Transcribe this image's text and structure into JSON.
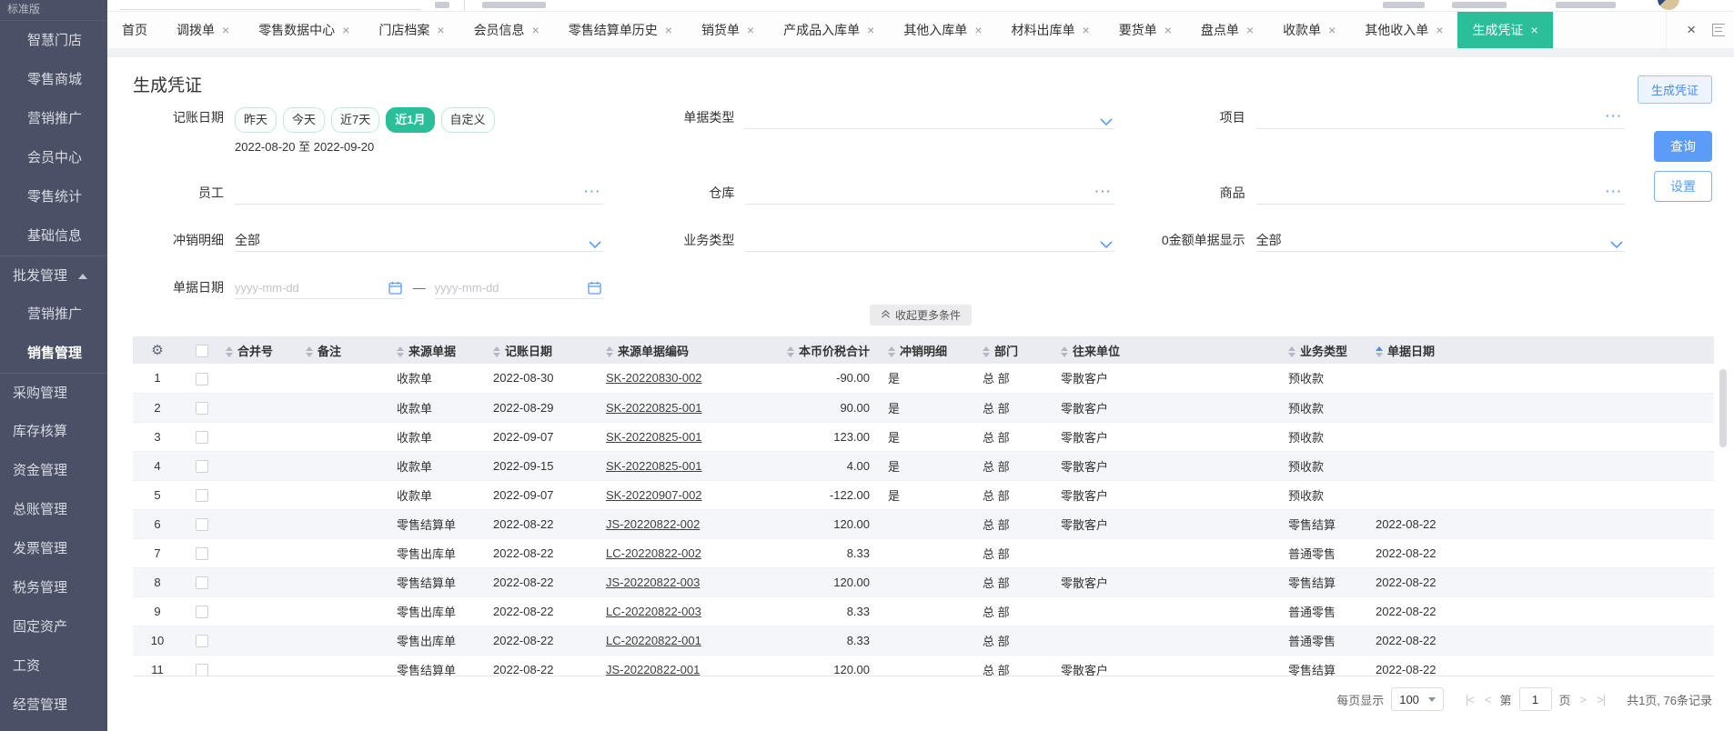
{
  "sidebar": {
    "edition_label": "标准版",
    "items": [
      {
        "label": "智慧门店",
        "level": 1
      },
      {
        "label": "零售商城",
        "level": 1
      },
      {
        "label": "营销推广",
        "level": 1
      },
      {
        "label": "会员中心",
        "level": 1
      },
      {
        "label": "零售统计",
        "level": 1
      },
      {
        "label": "基础信息",
        "level": 1
      },
      {
        "label": "批发管理",
        "level": 0,
        "expanded": true,
        "divider_above": true
      },
      {
        "label": "营销推广",
        "level": 1
      },
      {
        "label": "销售管理",
        "level": 1,
        "active": true
      },
      {
        "label": "采购管理",
        "level": 0,
        "divider_above": true
      },
      {
        "label": "库存核算",
        "level": 0
      },
      {
        "label": "资金管理",
        "level": 0
      },
      {
        "label": "总账管理",
        "level": 0
      },
      {
        "label": "发票管理",
        "level": 0
      },
      {
        "label": "税务管理",
        "level": 0
      },
      {
        "label": "固定资产",
        "level": 0
      },
      {
        "label": "工资",
        "level": 0
      },
      {
        "label": "经营管理",
        "level": 0
      }
    ]
  },
  "tabs": [
    {
      "label": "首页",
      "closable": false,
      "active": false
    },
    {
      "label": "调拨单",
      "closable": true,
      "active": false
    },
    {
      "label": "零售数据中心",
      "closable": true,
      "active": false
    },
    {
      "label": "门店档案",
      "closable": true,
      "active": false
    },
    {
      "label": "会员信息",
      "closable": true,
      "active": false
    },
    {
      "label": "零售结算单历史",
      "closable": true,
      "active": false
    },
    {
      "label": "销货单",
      "closable": true,
      "active": false
    },
    {
      "label": "产成品入库单",
      "closable": true,
      "active": false
    },
    {
      "label": "其他入库单",
      "closable": true,
      "active": false
    },
    {
      "label": "材料出库单",
      "closable": true,
      "active": false
    },
    {
      "label": "要货单",
      "closable": true,
      "active": false
    },
    {
      "label": "盘点单",
      "closable": true,
      "active": false
    },
    {
      "label": "收款单",
      "closable": true,
      "active": false
    },
    {
      "label": "其他收入单",
      "closable": true,
      "active": false
    },
    {
      "label": "生成凭证",
      "closable": true,
      "active": true
    }
  ],
  "page": {
    "title": "生成凭证",
    "generate_button_label": "生成凭证"
  },
  "filters": {
    "accounting_date": {
      "label": "记账日期",
      "quick_options": [
        "昨天",
        "今天",
        "近7天",
        "近1月",
        "自定义"
      ],
      "active_option": "近1月",
      "range_text": "2022-08-20 至 2022-09-20"
    },
    "doc_type": {
      "label": "单据类型",
      "value": ""
    },
    "project": {
      "label": "项目",
      "value": ""
    },
    "employee": {
      "label": "员工",
      "value": ""
    },
    "warehouse": {
      "label": "仓库",
      "value": ""
    },
    "goods": {
      "label": "商品",
      "value": ""
    },
    "writeoff_detail": {
      "label": "冲销明细",
      "value": "全部"
    },
    "business_type": {
      "label": "业务类型",
      "value": ""
    },
    "zero_amount": {
      "label": "0金额单据显示",
      "value": "全部"
    },
    "doc_date": {
      "label": "单据日期",
      "placeholder": "yyyy-mm-dd",
      "separator": "—"
    },
    "collapse_button_label": "收起更多条件",
    "query_button_label": "查询",
    "settings_button_label": "设置"
  },
  "table": {
    "columns": [
      "合并号",
      "备注",
      "来源单据",
      "记账日期",
      "来源单据编码",
      "本币价税合计",
      "冲销明细",
      "部门",
      "往来单位",
      "业务类型",
      "单据日期"
    ],
    "sorted_column": "单据日期",
    "sort_direction": "asc",
    "rows": [
      {
        "num": "1",
        "merge_no": "",
        "remark": "",
        "source_doc": "收款单",
        "acct_date": "2022-08-30",
        "code": "SK-20220830-002",
        "amount": "-90.00",
        "writeoff": "是",
        "dept": "总 部",
        "partner": "零散客户",
        "biz_type": "预收款",
        "doc_date": ""
      },
      {
        "num": "2",
        "merge_no": "",
        "remark": "",
        "source_doc": "收款单",
        "acct_date": "2022-08-29",
        "code": "SK-20220825-001",
        "amount": "90.00",
        "writeoff": "是",
        "dept": "总 部",
        "partner": "零散客户",
        "biz_type": "预收款",
        "doc_date": ""
      },
      {
        "num": "3",
        "merge_no": "",
        "remark": "",
        "source_doc": "收款单",
        "acct_date": "2022-09-07",
        "code": "SK-20220825-001",
        "amount": "123.00",
        "writeoff": "是",
        "dept": "总 部",
        "partner": "零散客户",
        "biz_type": "预收款",
        "doc_date": ""
      },
      {
        "num": "4",
        "merge_no": "",
        "remark": "",
        "source_doc": "收款单",
        "acct_date": "2022-09-15",
        "code": "SK-20220825-001",
        "amount": "4.00",
        "writeoff": "是",
        "dept": "总 部",
        "partner": "零散客户",
        "biz_type": "预收款",
        "doc_date": ""
      },
      {
        "num": "5",
        "merge_no": "",
        "remark": "",
        "source_doc": "收款单",
        "acct_date": "2022-09-07",
        "code": "SK-20220907-002",
        "amount": "-122.00",
        "writeoff": "是",
        "dept": "总 部",
        "partner": "零散客户",
        "biz_type": "预收款",
        "doc_date": ""
      },
      {
        "num": "6",
        "merge_no": "",
        "remark": "",
        "source_doc": "零售结算单",
        "acct_date": "2022-08-22",
        "code": "JS-20220822-002",
        "amount": "120.00",
        "writeoff": "",
        "dept": "总 部",
        "partner": "零散客户",
        "biz_type": "零售结算",
        "doc_date": "2022-08-22"
      },
      {
        "num": "7",
        "merge_no": "",
        "remark": "",
        "source_doc": "零售出库单",
        "acct_date": "2022-08-22",
        "code": "LC-20220822-002",
        "amount": "8.33",
        "writeoff": "",
        "dept": "总 部",
        "partner": "",
        "biz_type": "普通零售",
        "doc_date": "2022-08-22"
      },
      {
        "num": "8",
        "merge_no": "",
        "remark": "",
        "source_doc": "零售结算单",
        "acct_date": "2022-08-22",
        "code": "JS-20220822-003",
        "amount": "120.00",
        "writeoff": "",
        "dept": "总 部",
        "partner": "零散客户",
        "biz_type": "零售结算",
        "doc_date": "2022-08-22"
      },
      {
        "num": "9",
        "merge_no": "",
        "remark": "",
        "source_doc": "零售出库单",
        "acct_date": "2022-08-22",
        "code": "LC-20220822-003",
        "amount": "8.33",
        "writeoff": "",
        "dept": "总 部",
        "partner": "",
        "biz_type": "普通零售",
        "doc_date": "2022-08-22"
      },
      {
        "num": "10",
        "merge_no": "",
        "remark": "",
        "source_doc": "零售出库单",
        "acct_date": "2022-08-22",
        "code": "LC-20220822-001",
        "amount": "8.33",
        "writeoff": "",
        "dept": "总 部",
        "partner": "",
        "biz_type": "普通零售",
        "doc_date": "2022-08-22"
      },
      {
        "num": "11",
        "merge_no": "",
        "remark": "",
        "source_doc": "零售结算单",
        "acct_date": "2022-08-22",
        "code": "JS-20220822-001",
        "amount": "120.00",
        "writeoff": "",
        "dept": "总 部",
        "partner": "零散客户",
        "biz_type": "零售结算",
        "doc_date": "2022-08-22"
      }
    ]
  },
  "pagination": {
    "per_page_label": "每页显示",
    "per_page_value": "100",
    "page_prefix": "第",
    "page_value": "1",
    "page_suffix": "页",
    "total_text": "共1页, 76条记录"
  },
  "colors": {
    "accent_green": "#2bbf99",
    "accent_blue": "#5b9cf8",
    "sidebar_bg": "#4a5065",
    "table_header_bg": "#eaecf2"
  }
}
